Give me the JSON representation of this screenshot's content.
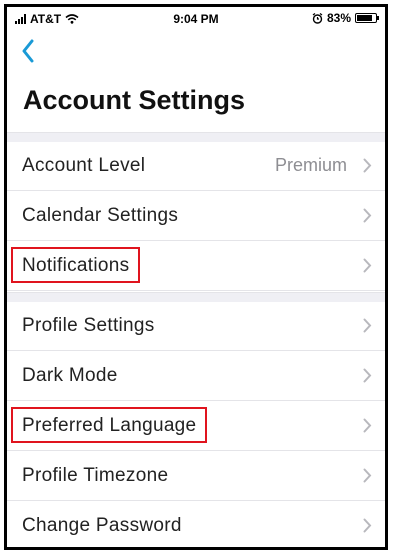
{
  "status": {
    "carrier": "AT&T",
    "time": "9:04 PM",
    "battery": "83%",
    "battery_level": 0.83
  },
  "nav": {
    "back_icon": "chevron-left-icon"
  },
  "title": "Account Settings",
  "colors": {
    "accent": "#1a9ad6",
    "highlight": "#e0141e",
    "section_bg": "#efeff4"
  },
  "sections": [
    {
      "rows": [
        {
          "label": "Account Level",
          "value": "Premium"
        },
        {
          "label": "Calendar Settings"
        },
        {
          "label": "Notifications",
          "highlighted": true
        }
      ]
    },
    {
      "rows": [
        {
          "label": "Profile Settings"
        },
        {
          "label": "Dark Mode"
        },
        {
          "label": "Preferred Language",
          "highlighted": true
        },
        {
          "label": "Profile Timezone"
        },
        {
          "label": "Change Password"
        }
      ]
    }
  ]
}
